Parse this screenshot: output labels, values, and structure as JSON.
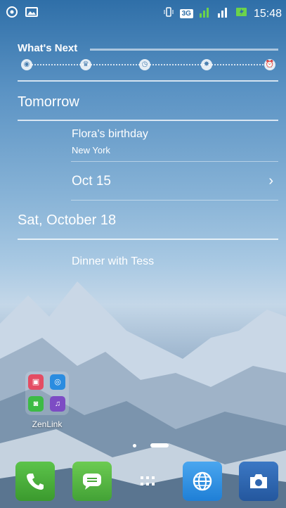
{
  "status_bar": {
    "left_icons": [
      "settings-icon",
      "image-icon"
    ],
    "right_icons": [
      "vibrate-icon",
      "signal-3g-icon",
      "signal-icon",
      "signal-2-icon",
      "battery-charging-icon"
    ],
    "network": "3G",
    "time": "15:48"
  },
  "whats_next": {
    "title": "What's Next",
    "timeline_icons": [
      "eye-icon",
      "cake-icon",
      "clock-icon",
      "meeting-icon",
      "alarm-icon"
    ]
  },
  "sections": [
    {
      "heading": "Tomorrow",
      "events": [
        {
          "title": "Flora's birthday",
          "location": "New York"
        }
      ],
      "date_row": {
        "label": "Oct 15"
      }
    },
    {
      "heading": "Sat, October 18",
      "events": [
        {
          "title": "Dinner with Tess"
        }
      ]
    }
  ],
  "folder": {
    "label": "ZenLink",
    "apps": [
      "share-link-icon",
      "remote-link-icon",
      "pc-link-icon",
      "party-link-icon"
    ]
  },
  "pager": {
    "pages": 2,
    "current": 2
  },
  "dock": {
    "apps": [
      {
        "name": "phone-icon",
        "color": "#4cae3b"
      },
      {
        "name": "messaging-icon",
        "color": "#5db33e"
      },
      {
        "name": "all-apps-icon",
        "color": "transparent"
      },
      {
        "name": "browser-icon",
        "color": "#2b8fe0"
      },
      {
        "name": "camera-icon",
        "color": "#2f66b0"
      }
    ]
  }
}
